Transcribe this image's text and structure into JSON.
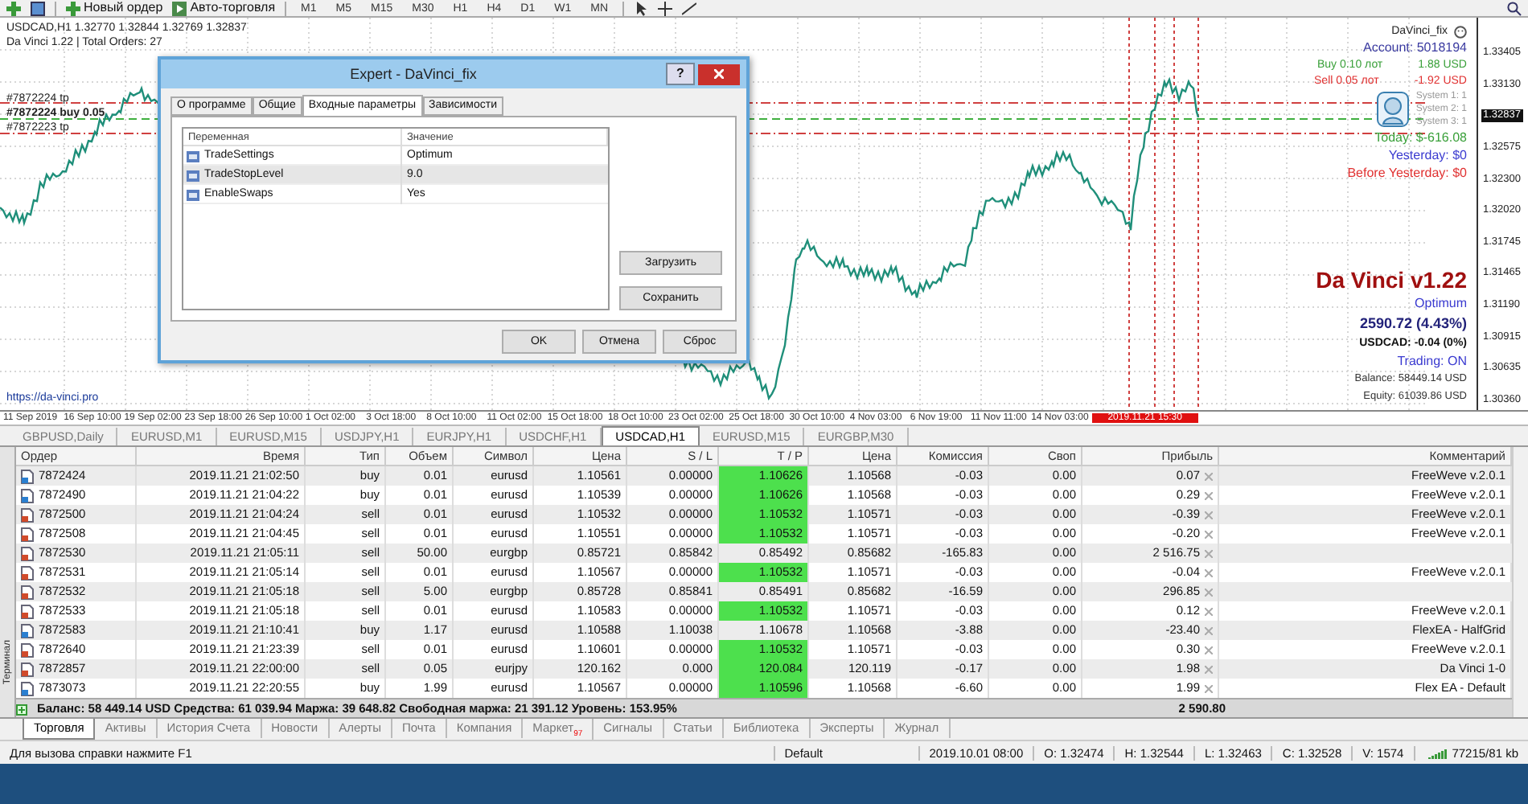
{
  "toolbar": {
    "buttons": [
      {
        "label": "Новый ордер",
        "kind": "order"
      },
      {
        "label": "Авто-торговля",
        "kind": "auto"
      }
    ],
    "timeframes": [
      "M1",
      "M5",
      "M15",
      "M30",
      "H1",
      "H4",
      "D1",
      "W1",
      "MN"
    ]
  },
  "chart": {
    "symbol_line": "USDCAD,H1  1.32770 1.32844 1.32769 1.32837",
    "expert_line": "Da Vinci 1.22 | Total Orders: 27",
    "order_labels": [
      "#7872224 tp",
      "#7872224 buy 0.05",
      "#7872223 tp"
    ],
    "link": "https://da-vinci.pro",
    "info": {
      "expert": "DaVinci_fix",
      "account": "Account: 5018194",
      "positions": [
        {
          "label": "Buy 0.10 лот",
          "value": "1.88 USD",
          "kind": "buy"
        },
        {
          "label": "Sell 0.05 лот",
          "value": "-1.92 USD",
          "kind": "sell"
        }
      ],
      "systems": [
        "System 1: 1",
        "System 2: 1",
        "System 3: 1"
      ],
      "today": "Today: $-616.08",
      "yesterday": "Yesterday: $0",
      "before_yesterday": "Before Yesterday: $0",
      "title": "Da Vinci v1.22",
      "mode": "Optimum",
      "result": "2590.72 (4.43%)",
      "symbol_result": "USDCAD: -0.04 (0%)",
      "trading": "Trading: ON",
      "balance": "Balance: 58449.14 USD",
      "equity": "Equity: 61039.86 USD"
    },
    "price_axis": [
      {
        "label": "1.33405",
        "current": false
      },
      {
        "label": "1.33130",
        "current": false
      },
      {
        "label": "1.32837",
        "current": true
      },
      {
        "label": "1.32575",
        "current": false
      },
      {
        "label": "1.32300",
        "current": false
      },
      {
        "label": "1.32020",
        "current": false
      },
      {
        "label": "1.31745",
        "current": false
      },
      {
        "label": "1.31465",
        "current": false
      },
      {
        "label": "1.31190",
        "current": false
      },
      {
        "label": "1.30915",
        "current": false
      },
      {
        "label": "1.30635",
        "current": false
      },
      {
        "label": "1.30360",
        "current": false
      }
    ],
    "time_axis": [
      "11 Sep 2019",
      "16 Sep 10:00",
      "19 Sep 02:00",
      "23 Sep 18:00",
      "26 Sep 10:00",
      "1 Oct 02:00",
      "3 Oct 18:00",
      "8 Oct 10:00",
      "11 Oct 02:00",
      "15 Oct 18:00",
      "18 Oct 10:00",
      "23 Oct 02:00",
      "25 Oct 18:00",
      "30 Oct 10:00",
      "4 Nov 03:00",
      "6 Nov 19:00",
      "11 Nov 11:00",
      "14 Nov 03:00"
    ],
    "time_marker": "2019.11.21 15:30"
  },
  "dialog": {
    "title": "Expert - DaVinci_fix",
    "help": "?",
    "tabs": [
      {
        "label": "О программе",
        "selected": false
      },
      {
        "label": "Общие",
        "selected": false
      },
      {
        "label": "Входные параметры",
        "selected": true
      },
      {
        "label": "Зависимости",
        "selected": false
      }
    ],
    "columns": [
      "Переменная",
      "Значение"
    ],
    "params": [
      {
        "name": "TradeSettings",
        "value": "Optimum",
        "selected": false
      },
      {
        "name": "TradeStopLevel",
        "value": "9.0",
        "selected": true
      },
      {
        "name": "EnableSwaps",
        "value": "Yes",
        "selected": false
      }
    ],
    "side_buttons": [
      "Загрузить",
      "Сохранить"
    ],
    "buttons": [
      "OK",
      "Отмена",
      "Сброс"
    ]
  },
  "chart_tabs": [
    {
      "label": "GBPUSD,Daily",
      "selected": false
    },
    {
      "label": "EURUSD,M1",
      "selected": false
    },
    {
      "label": "EURUSD,M15",
      "selected": false
    },
    {
      "label": "USDJPY,H1",
      "selected": false
    },
    {
      "label": "EURJPY,H1",
      "selected": false
    },
    {
      "label": "USDCHF,H1",
      "selected": false
    },
    {
      "label": "USDCAD,H1",
      "selected": true
    },
    {
      "label": "EURUSD,M15",
      "selected": false
    },
    {
      "label": "EURGBP,M30",
      "selected": false
    }
  ],
  "orders": {
    "columns": [
      "Ордер",
      "Время",
      "Тип",
      "Объем",
      "Символ",
      "Цена",
      "S / L",
      "T / P",
      "Цена",
      "Комиссия",
      "Своп",
      "Прибыль",
      "Комментарий"
    ],
    "rows": [
      {
        "kind": "buy",
        "cells": [
          "7872424",
          "2019.11.21 21:02:50",
          "buy",
          "0.01",
          "eurusd",
          "1.10561",
          "0.00000",
          "1.10626",
          "1.10568",
          "-0.03",
          "0.00",
          "0.07",
          "FreeWeve v.2.0.1"
        ],
        "tp_hit": true
      },
      {
        "kind": "buy",
        "cells": [
          "7872490",
          "2019.11.21 21:04:22",
          "buy",
          "0.01",
          "eurusd",
          "1.10539",
          "0.00000",
          "1.10626",
          "1.10568",
          "-0.03",
          "0.00",
          "0.29",
          "FreeWeve v.2.0.1"
        ],
        "tp_hit": true
      },
      {
        "kind": "sell",
        "cells": [
          "7872500",
          "2019.11.21 21:04:24",
          "sell",
          "0.01",
          "eurusd",
          "1.10532",
          "0.00000",
          "1.10532",
          "1.10571",
          "-0.03",
          "0.00",
          "-0.39",
          "FreeWeve v.2.0.1"
        ],
        "tp_hit": true
      },
      {
        "kind": "sell",
        "cells": [
          "7872508",
          "2019.11.21 21:04:45",
          "sell",
          "0.01",
          "eurusd",
          "1.10551",
          "0.00000",
          "1.10532",
          "1.10571",
          "-0.03",
          "0.00",
          "-0.20",
          "FreeWeve v.2.0.1"
        ],
        "tp_hit": true
      },
      {
        "kind": "sell",
        "cells": [
          "7872530",
          "2019.11.21 21:05:11",
          "sell",
          "50.00",
          "eurgbp",
          "0.85721",
          "0.85842",
          "0.85492",
          "0.85682",
          "-165.83",
          "0.00",
          "2 516.75",
          ""
        ],
        "tp_hit": false
      },
      {
        "kind": "sell",
        "cells": [
          "7872531",
          "2019.11.21 21:05:14",
          "sell",
          "0.01",
          "eurusd",
          "1.10567",
          "0.00000",
          "1.10532",
          "1.10571",
          "-0.03",
          "0.00",
          "-0.04",
          "FreeWeve v.2.0.1"
        ],
        "tp_hit": true
      },
      {
        "kind": "sell",
        "cells": [
          "7872532",
          "2019.11.21 21:05:18",
          "sell",
          "5.00",
          "eurgbp",
          "0.85728",
          "0.85841",
          "0.85491",
          "0.85682",
          "-16.59",
          "0.00",
          "296.85",
          ""
        ],
        "tp_hit": false
      },
      {
        "kind": "sell",
        "cells": [
          "7872533",
          "2019.11.21 21:05:18",
          "sell",
          "0.01",
          "eurusd",
          "1.10583",
          "0.00000",
          "1.10532",
          "1.10571",
          "-0.03",
          "0.00",
          "0.12",
          "FreeWeve v.2.0.1"
        ],
        "tp_hit": true
      },
      {
        "kind": "buy",
        "cells": [
          "7872583",
          "2019.11.21 21:10:41",
          "buy",
          "1.17",
          "eurusd",
          "1.10588",
          "1.10038",
          "1.10678",
          "1.10568",
          "-3.88",
          "0.00",
          "-23.40",
          "FlexEA - HalfGrid"
        ],
        "tp_hit": false
      },
      {
        "kind": "sell",
        "cells": [
          "7872640",
          "2019.11.21 21:23:39",
          "sell",
          "0.01",
          "eurusd",
          "1.10601",
          "0.00000",
          "1.10532",
          "1.10571",
          "-0.03",
          "0.00",
          "0.30",
          "FreeWeve v.2.0.1"
        ],
        "tp_hit": true
      },
      {
        "kind": "sell",
        "cells": [
          "7872857",
          "2019.11.21 22:00:00",
          "sell",
          "0.05",
          "eurjpy",
          "120.162",
          "0.000",
          "120.084",
          "120.119",
          "-0.17",
          "0.00",
          "1.98",
          "Da Vinci 1-0"
        ],
        "tp_hit": true
      },
      {
        "kind": "buy",
        "cells": [
          "7873073",
          "2019.11.21 22:20:55",
          "buy",
          "1.99",
          "eurusd",
          "1.10567",
          "0.00000",
          "1.10596",
          "1.10568",
          "-6.60",
          "0.00",
          "1.99",
          "Flex EA - Default"
        ],
        "tp_hit": true
      }
    ],
    "summary": "Баланс: 58 449.14 USD  Средства: 61 039.94  Маржа: 39 648.82  Свободная маржа: 21 391.12  Уровень: 153.95%",
    "total": "2 590.80"
  },
  "terminal_label": "Терминал",
  "terminal_tabs": [
    {
      "label": "Торговля",
      "selected": true
    },
    {
      "label": "Активы",
      "selected": false
    },
    {
      "label": "История Счета",
      "selected": false
    },
    {
      "label": "Новости",
      "selected": false
    },
    {
      "label": "Алерты",
      "selected": false
    },
    {
      "label": "Почта",
      "selected": false
    },
    {
      "label": "Компания",
      "selected": false
    },
    {
      "label": "Маркет",
      "badge": "97",
      "selected": false
    },
    {
      "label": "Сигналы",
      "selected": false
    },
    {
      "label": "Статьи",
      "selected": false
    },
    {
      "label": "Библиотека",
      "selected": false
    },
    {
      "label": "Эксперты",
      "selected": false
    },
    {
      "label": "Журнал",
      "selected": false
    }
  ],
  "status_bar": {
    "help": "Для вызова справки нажмите F1",
    "profile": "Default",
    "time": "2019.10.01 08:00",
    "open": "O: 1.32474",
    "high": "H: 1.32544",
    "low": "L: 1.32463",
    "close": "C: 1.32528",
    "volume": "V: 1574",
    "traffic": "77215/81 kb"
  }
}
